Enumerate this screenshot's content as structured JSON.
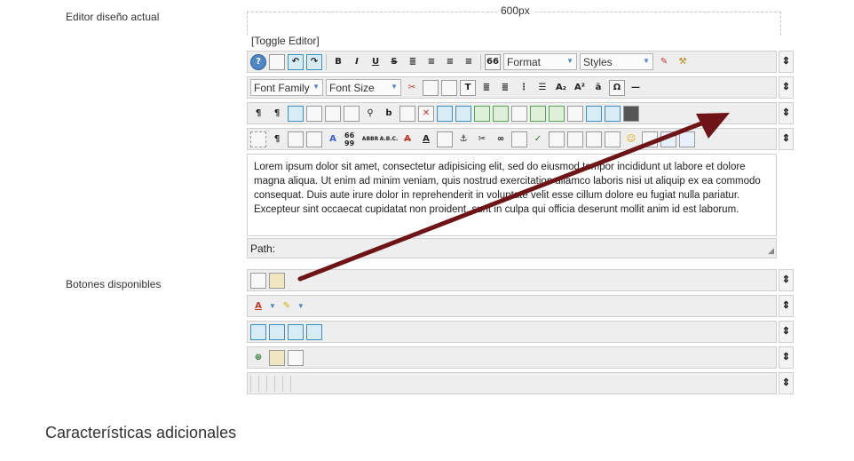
{
  "labels": {
    "current_editor": "Editor diseño actual",
    "available_buttons": "Botones disponibles",
    "additional_features": "Características adicionales"
  },
  "editor": {
    "width_label": "600px",
    "toggle_label": "[Toggle Editor]",
    "format_label": "Format",
    "styles_label": "Styles",
    "font_family_label": "Font Family",
    "font_size_label": "Font Size",
    "content_text": "Lorem ipsum dolor sit amet, consectetur adipisicing elit, sed do eiusmod tempor incididunt ut labore et dolore magna aliqua. Ut enim ad minim veniam, quis nostrud exercitation ullamco laboris nisi ut aliquip ex ea commodo consequat. Duis aute irure dolor in reprehenderit in voluptate velit esse cillum dolore eu fugiat nulla pariatur. Excepteur sint occaecat cupidatat non proident, sunt in culpa qui officia deserunt mollit anim id est laborum.",
    "path_label": "Path:",
    "handle_glyph": "⇕"
  },
  "icons": {
    "help": "?",
    "bold": "B",
    "italic": "I",
    "underline": "U",
    "strike": "S",
    "quote": "66",
    "subscript": "A₂",
    "superscript": "A²",
    "charmap": "Ω",
    "pilcrow": "¶",
    "abbr": "ABBR",
    "acronym": "A.B.C.",
    "cite": "66 99",
    "font_color": "A"
  },
  "colors": {
    "arrow": "#6e1416",
    "accent": "#4f86c6"
  }
}
